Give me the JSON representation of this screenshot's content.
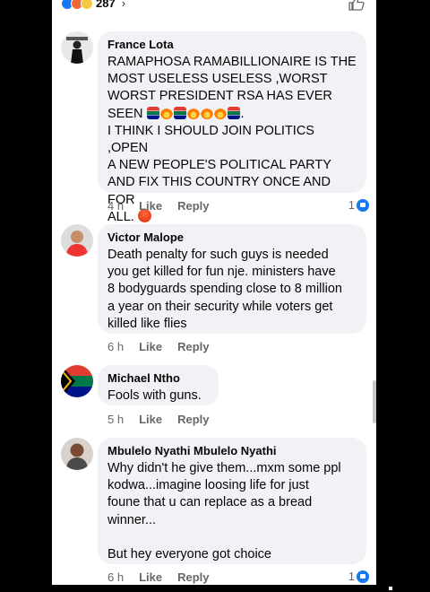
{
  "header": {
    "reaction_count": "287",
    "reaction_icons": [
      "like-icon",
      "angry-icon",
      "sad-icon"
    ],
    "chevron": "›"
  },
  "comments": [
    {
      "author": "France Lota",
      "avatar_icon": "avatar-france-lota",
      "lines": [
        "RAMAPHOSA RAMABILLIONAIRE IS THE",
        "MOST USELESS USELESS ,WORST",
        "WORST PRESIDENT  RSA HAS EVER",
        "SEEN ",
        "I THINK I SHOULD JOIN POLITICS ,OPEN",
        "A NEW PEOPLE'S POLITICAL PARTY",
        "AND FIX THIS COUNTRY ONCE AND FOR",
        "ALL. "
      ],
      "time": "4 h",
      "like_label": "Like",
      "reply_label": "Reply",
      "reactions": "1"
    },
    {
      "author": "Victor Malope",
      "avatar_icon": "avatar-victor-malope",
      "lines": [
        "Death penalty for such guys is needed",
        "you get killed for fun nje.  ministers have",
        "8 bodyguards spending close to 8 million",
        "a year on their security while voters get",
        "killed like flies"
      ],
      "time": "6 h",
      "like_label": "Like",
      "reply_label": "Reply"
    },
    {
      "author": "Michael Ntho",
      "avatar_icon": "avatar-michael-ntho",
      "lines": [
        "Fools with guns."
      ],
      "time": "5 h",
      "like_label": "Like",
      "reply_label": "Reply"
    },
    {
      "author": "Mbulelo Nyathi Mbulelo Nyathi",
      "avatar_icon": "avatar-mbulelo-nyathi",
      "lines": [
        "Why didn't he give them...mxm some ppl",
        "kodwa...imagine loosing life for just",
        "foune that u can replace as a bread",
        "winner...",
        "",
        "But hey everyone got choice"
      ],
      "time": "6 h",
      "like_label": "Like",
      "reply_label": "Reply",
      "reactions": "1"
    }
  ],
  "colors": {
    "bubble": "#f0f2f5",
    "meta": "#65676b",
    "like_blue": "#1877f2"
  }
}
